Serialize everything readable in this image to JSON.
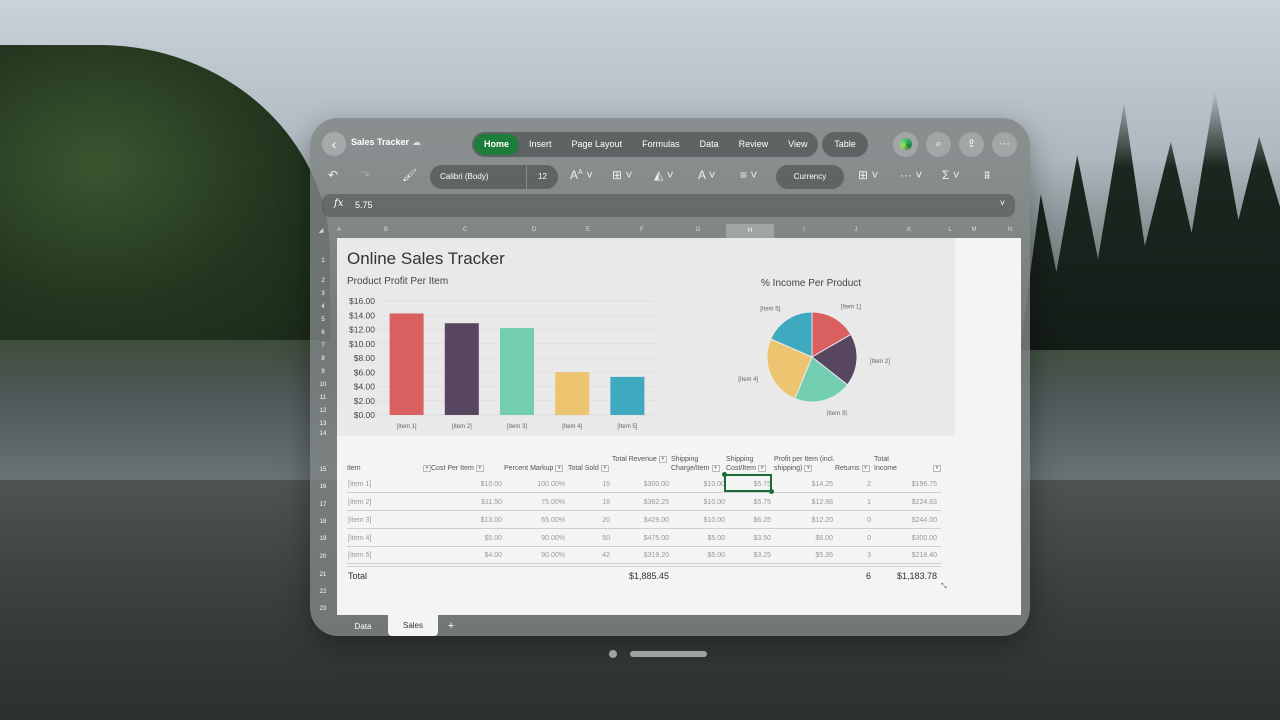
{
  "app": {
    "doc_title": "Sales Tracker",
    "tabs": [
      "Home",
      "Insert",
      "Page Layout",
      "Formulas",
      "Data",
      "Review",
      "View"
    ],
    "active_tab": "Home",
    "table_tab": "Table"
  },
  "toolbar": {
    "font_name": "Calibri (Body)",
    "font_size": "12",
    "number_format": "Currency"
  },
  "formula_bar": {
    "fx_label": "fx",
    "value": "5.75"
  },
  "columns": [
    "A",
    "B",
    "C",
    "D",
    "E",
    "F",
    "G",
    "H",
    "I",
    "J",
    "K",
    "L",
    "M",
    "N"
  ],
  "selected_column": "H",
  "rows": [
    "1",
    "2",
    "3",
    "4",
    "5",
    "6",
    "7",
    "8",
    "9",
    "10",
    "11",
    "12",
    "13",
    "14",
    "15",
    "16",
    "17",
    "18",
    "19",
    "20",
    "21",
    "22",
    "23"
  ],
  "sheet": {
    "title": "Online Sales Tracker",
    "bar_chart_title": "Product Profit Per Item",
    "pie_chart_title": "% Income Per Product"
  },
  "chart_data": [
    {
      "type": "bar",
      "title": "Product Profit Per Item",
      "categories": [
        "[Item 1]",
        "[Item 2]",
        "[Item 3]",
        "[Item 4]",
        "[Item 5]"
      ],
      "values": [
        14.25,
        12.88,
        12.2,
        6.0,
        5.35
      ],
      "colors": [
        "#d9605f",
        "#584560",
        "#73cdb0",
        "#edc46f",
        "#3fa9bf"
      ],
      "yticks": [
        "$0.00",
        "$2.00",
        "$4.00",
        "$6.00",
        "$8.00",
        "$10.00",
        "$12.00",
        "$14.00",
        "$16.00"
      ],
      "ylim": [
        0,
        16
      ]
    },
    {
      "type": "pie",
      "title": "% Income Per Product",
      "labels": [
        "[Item 1]",
        "[Item 2]",
        "[Item 3]",
        "[Item 4]",
        "[Item 5]"
      ],
      "values": [
        196.75,
        224.63,
        244.0,
        300.0,
        218.4
      ],
      "colors": [
        "#d9605f",
        "#584560",
        "#73cdb0",
        "#edc46f",
        "#3fa9bf"
      ]
    }
  ],
  "table": {
    "headers": [
      "Item",
      "Cost Per Item",
      "Percent Markup",
      "Total Sold",
      "Total Revenue",
      "Shipping Charge/Item",
      "Shipping Cost/Item",
      "Profit per Item (incl. shipping)",
      "Returns",
      "Total Income"
    ],
    "rows": [
      [
        "[Item 1]",
        "$10.00",
        "100.00%",
        "15",
        "$300.00",
        "$10.00",
        "$5.75",
        "$14.25",
        "2",
        "$196.75"
      ],
      [
        "[Item 2]",
        "$11.50",
        "75.00%",
        "18",
        "$362.25",
        "$10.00",
        "$5.75",
        "$12.88",
        "1",
        "$224.63"
      ],
      [
        "[Item 3]",
        "$13.00",
        "65.00%",
        "20",
        "$429.00",
        "$10.00",
        "$6.25",
        "$12.20",
        "0",
        "$244.00"
      ],
      [
        "[Item 4]",
        "$5.00",
        "90.00%",
        "50",
        "$475.00",
        "$5.00",
        "$3.50",
        "$6.00",
        "0",
        "$300.00"
      ],
      [
        "[Item 5]",
        "$4.00",
        "90.00%",
        "42",
        "$319.20",
        "$5.00",
        "$3.25",
        "$5.35",
        "3",
        "$218.40"
      ]
    ],
    "total_label": "Total",
    "total_revenue": "$1,885.45",
    "total_returns": "6",
    "total_income": "$1,183.78"
  },
  "sheet_tabs": [
    "Data",
    "Sales"
  ],
  "active_sheet": "Sales",
  "add_sheet": "+"
}
